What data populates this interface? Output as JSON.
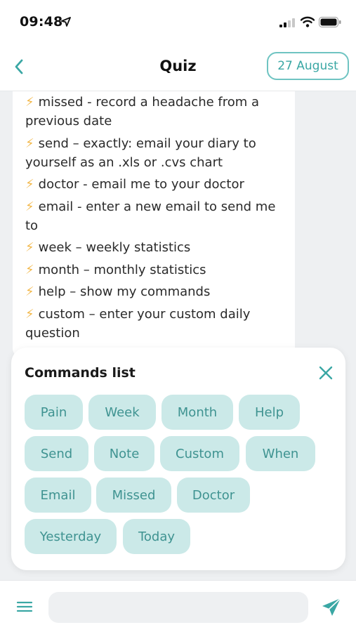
{
  "status_bar": {
    "time": "09:48"
  },
  "header": {
    "title": "Quiz",
    "date": "27 August"
  },
  "chat": {
    "commands": [
      {
        "icon": "⚡",
        "text": "missed  - record a headache from a previous date"
      },
      {
        "icon": "⚡",
        "text": "send – exactly: email your diary to yourself as an .xls or .cvs chart"
      },
      {
        "icon": "⚡",
        "text": "doctor - email me to your doctor"
      },
      {
        "icon": "⚡",
        "text": "email - enter a new email to send me to"
      },
      {
        "icon": "⚡",
        "text": "week – weekly statistics"
      },
      {
        "icon": "⚡",
        "text": "month – monthly statistics"
      },
      {
        "icon": "⚡",
        "text": "help – show my commands"
      },
      {
        "icon": "⚡",
        "text": "custom – enter your custom daily question"
      }
    ]
  },
  "commands_sheet": {
    "title": "Commands list",
    "chips": [
      "Pain",
      "Week",
      "Month",
      "Help",
      "Send",
      "Note",
      "Custom",
      "When",
      "Email",
      "Missed",
      "Doctor",
      "Yesterday",
      "Today"
    ]
  },
  "input_bar": {
    "value": "",
    "placeholder": ""
  },
  "colors": {
    "accent": "#3aa7a4",
    "chip_bg": "#cbe9e8",
    "chip_text": "#3f9391",
    "bolt": "#f2b84b"
  }
}
